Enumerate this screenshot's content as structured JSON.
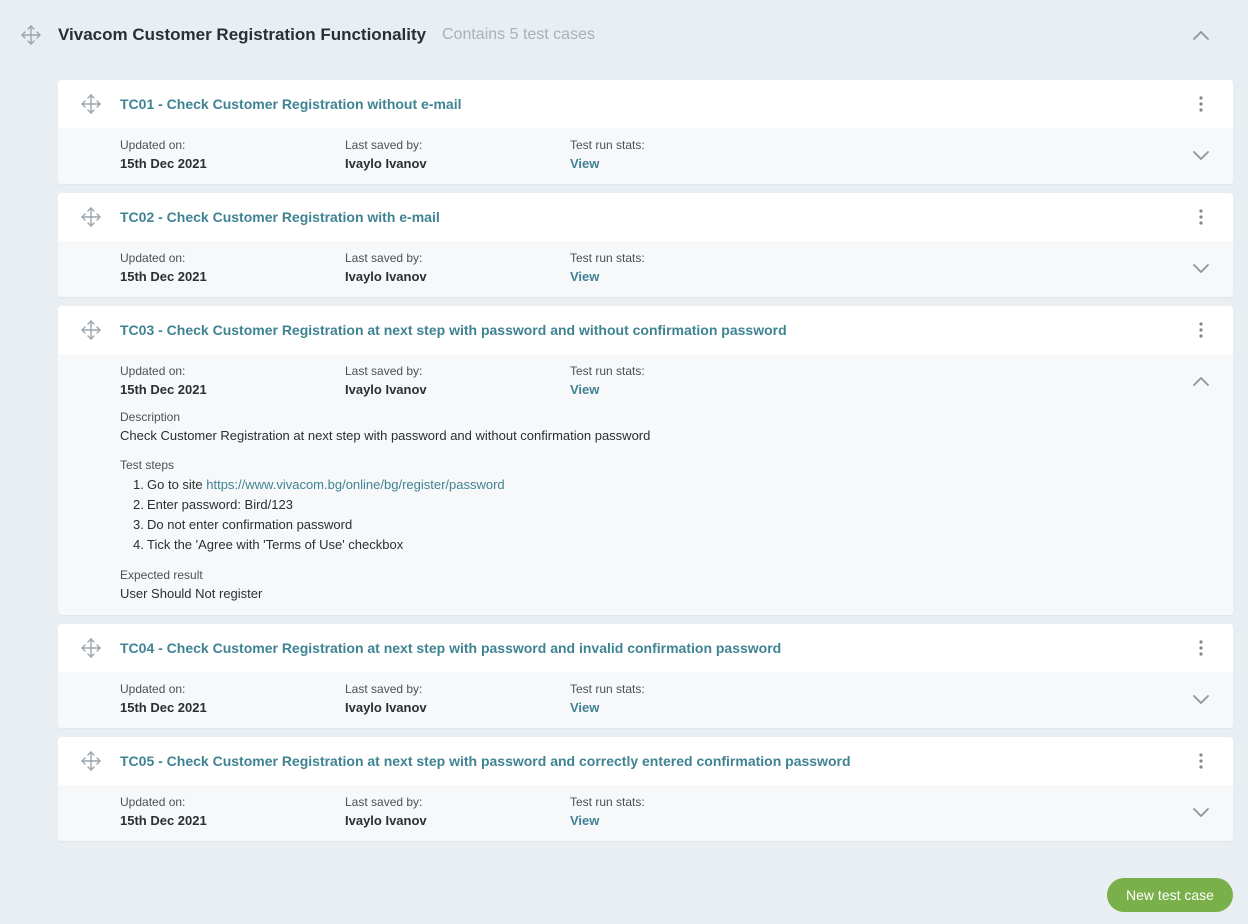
{
  "suite": {
    "title": "Vivacom Customer Registration Functionality",
    "count_text": "Contains 5 test cases"
  },
  "labels": {
    "updated_on": "Updated on:",
    "last_saved_by": "Last saved by:",
    "test_run_stats": "Test run stats:",
    "description": "Description",
    "test_steps": "Test steps",
    "expected_result": "Expected result"
  },
  "cases": [
    {
      "id": "TC01",
      "title": "TC01 - Check Customer Registration without e-mail",
      "updated": "15th Dec 2021",
      "saved_by": "Ivaylo Ivanov",
      "stats_link": "View",
      "expanded": false
    },
    {
      "id": "TC02",
      "title": "TC02 - Check Customer Registration with e-mail",
      "updated": "15th Dec 2021",
      "saved_by": "Ivaylo Ivanov",
      "stats_link": "View",
      "expanded": false
    },
    {
      "id": "TC03",
      "title": "TC03 - Check Customer Registration at next step with password and without confirmation password",
      "updated": "15th Dec 2021",
      "saved_by": "Ivaylo Ivanov",
      "stats_link": "View",
      "expanded": true,
      "description": "Check Customer Registration at next step with password and without confirmation password",
      "steps": [
        {
          "num": "1.",
          "text": "Go to site ",
          "link": "https://www.vivacom.bg/online/bg/register/password"
        },
        {
          "num": "2.",
          "text": "Enter password: Bird/123"
        },
        {
          "num": "3.",
          "text": "Do not enter confirmation password"
        },
        {
          "num": "4.",
          "text": "Tick the 'Agree with 'Terms of Use' checkbox"
        }
      ],
      "expected": "User Should Not register"
    },
    {
      "id": "TC04",
      "title": "TC04 - Check Customer Registration at next step with password and invalid confirmation password",
      "updated": "15th Dec 2021",
      "saved_by": "Ivaylo Ivanov",
      "stats_link": "View",
      "expanded": false
    },
    {
      "id": "TC05",
      "title": "TC05 - Check Customer Registration at next step with password and correctly entered confirmation password",
      "updated": "15th Dec 2021",
      "saved_by": "Ivaylo Ivanov",
      "stats_link": "View",
      "expanded": false
    }
  ],
  "actions": {
    "new_test_case": "New test case"
  },
  "colors": {
    "accent": "#3f8393",
    "button": "#7ab04a",
    "background": "#e9eef2"
  },
  "icons": {
    "drag": "move-arrows-icon",
    "menu": "kebab-menu-icon",
    "expand": "chevron-down-icon",
    "collapse": "chevron-up-icon"
  }
}
